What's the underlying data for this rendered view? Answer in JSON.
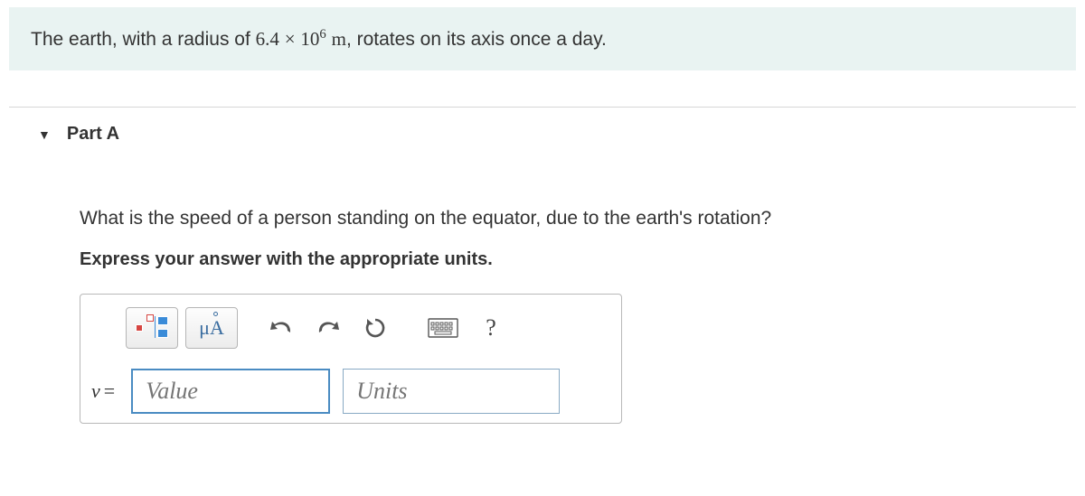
{
  "problem": {
    "prefix": "The earth, with a radius of ",
    "radius_coeff": "6.4",
    "times": "×",
    "radius_base": "10",
    "radius_exp": "6",
    "radius_unit": " m",
    "suffix": ", rotates on its axis once a day."
  },
  "part": {
    "label": "Part A",
    "question": "What is the speed of a person standing on the equator, due to the earth's rotation?",
    "instruction": "Express your answer with the appropriate units."
  },
  "toolbar": {
    "templates_name": "templates-button",
    "units_btn_label": "μA",
    "undo_name": "undo-button",
    "redo_name": "redo-button",
    "reset_name": "reset-button",
    "keyboard_name": "keyboard-button",
    "help_name": "help-button",
    "help_symbol": "?"
  },
  "answer": {
    "var": "v",
    "eq": "=",
    "value_placeholder": "Value",
    "units_placeholder": "Units"
  }
}
